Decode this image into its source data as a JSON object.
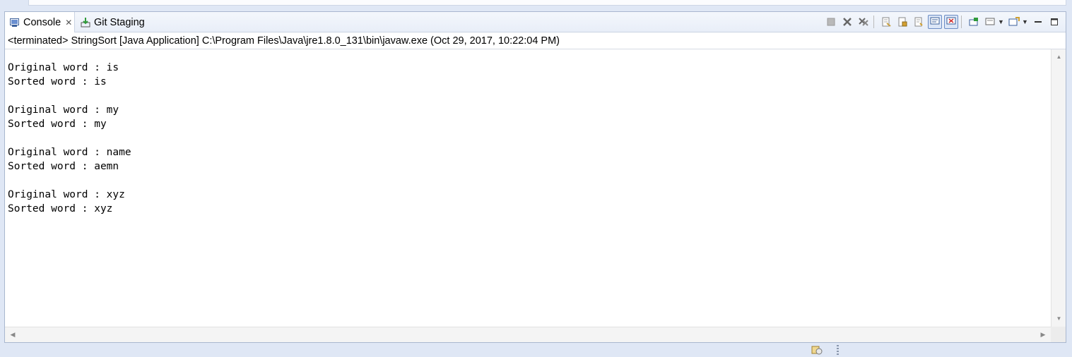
{
  "tabs": {
    "console": {
      "label": "Console",
      "close": "✕"
    },
    "git_staging": {
      "label": "Git Staging"
    }
  },
  "toolbar": {
    "icons": [
      "terminate-icon",
      "remove-launch-icon",
      "remove-all-terminated-icon",
      "clear-console-icon",
      "scroll-lock-icon",
      "word-wrap-icon",
      "show-on-stdout-icon",
      "show-on-stderr-icon",
      "pin-console-icon",
      "display-selected-console-icon",
      "open-console-icon",
      "minimize-icon",
      "maximize-icon"
    ]
  },
  "status_line": "<terminated> StringSort [Java Application] C:\\Program Files\\Java\\jre1.8.0_131\\bin\\javaw.exe (Oct 29, 2017, 10:22:04 PM)",
  "console_output": [
    {
      "original": "Original word : is",
      "sorted": "Sorted word : is"
    },
    {
      "original": "Original word : my",
      "sorted": "Sorted word : my"
    },
    {
      "original": "Original word : name",
      "sorted": "Sorted word : aemn"
    },
    {
      "original": "Original word : xyz",
      "sorted": "Sorted word : xyz"
    }
  ],
  "colors": {
    "frame_bg": "#dfe7f5",
    "view_border": "#a9b7cf",
    "pressed_button": "#dbe6f7"
  }
}
